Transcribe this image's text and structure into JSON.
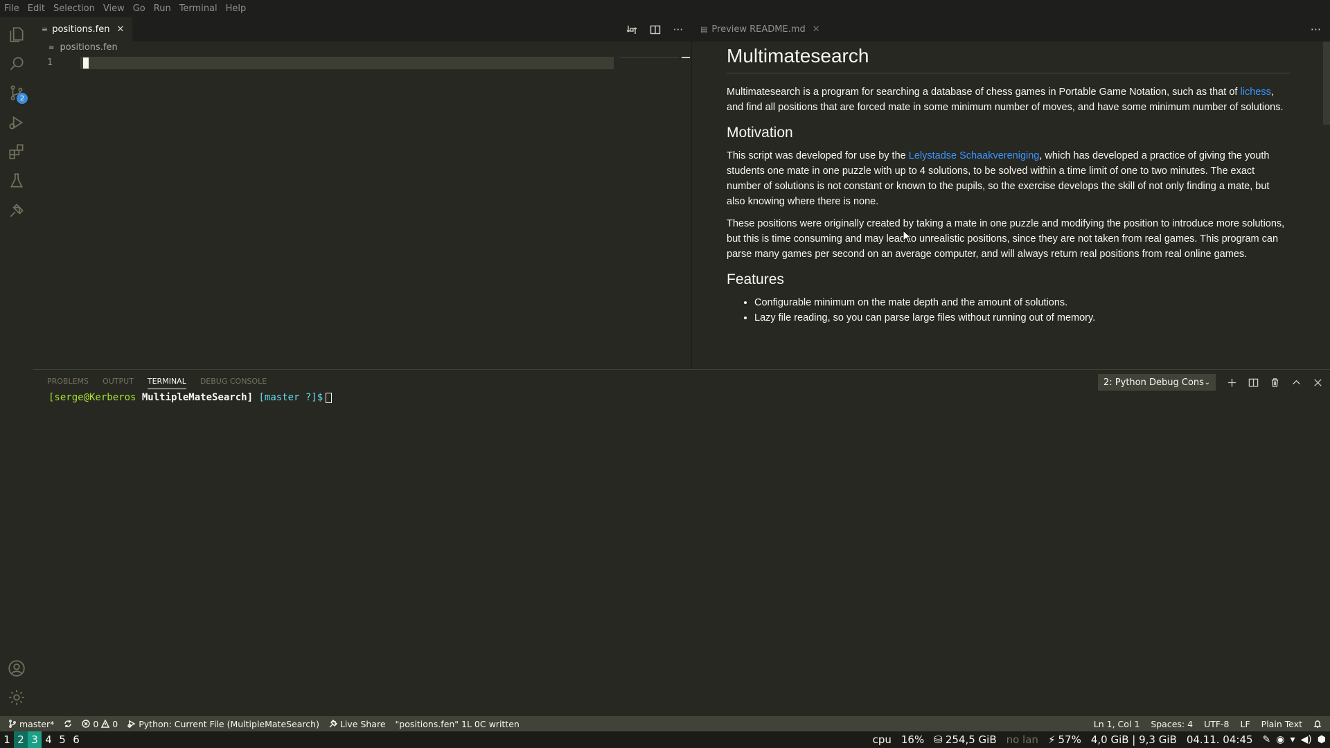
{
  "menu": [
    "File",
    "Edit",
    "Selection",
    "View",
    "Go",
    "Run",
    "Terminal",
    "Help"
  ],
  "activity": {
    "source_control_badge": "2"
  },
  "editor1": {
    "tab_label": "positions.fen",
    "tab_close": "✕",
    "breadcrumb": "positions.fen",
    "line_number": "1",
    "more": "···"
  },
  "editor2": {
    "tab_label": "Preview README.md",
    "tab_close": "✕",
    "more": "···",
    "doc": {
      "h1": "Multimatesearch",
      "p1_a": "Multimatesearch is a program for searching a database of chess games in Portable Game Notation, such as that of ",
      "p1_link": "lichess",
      "p1_b": ", and find all positions that are forced mate in some minimum number of moves, and have some minimum number of solutions.",
      "h2_motivation": "Motivation",
      "p2_a": "This script was developed for use by the ",
      "p2_link": "Lelystadse Schaakvereniging",
      "p2_b": ", which has developed a practice of giving the youth students one mate in one puzzle with up to 4 solutions, to be solved within a time limit of one to two minutes. The exact number of solutions is not constant or known to the pupils, so the exercise develops the skill of not only finding a mate, but also knowing where there is none.",
      "p3": "These positions were originally created by taking a mate in one puzzle and modifying the position to introduce more solutions, but this is time consuming and may lead to unrealistic positions, since they are not taken from real games. This program can parse many games per second on an average computer, and will always return real positions from real online games.",
      "h2_features": "Features",
      "features": [
        "Configurable minimum on the mate depth and the amount of solutions.",
        "Lazy file reading, so you can parse large files without running out of memory."
      ]
    }
  },
  "panel": {
    "tabs": [
      "PROBLEMS",
      "OUTPUT",
      "TERMINAL",
      "DEBUG CONSOLE"
    ],
    "active_tab": "TERMINAL",
    "terminal_select": "2: Python Debug Cons",
    "prompt_user": "[serge@Kerberos",
    "prompt_dir": "MultipleMateSearch]",
    "prompt_branch": "[master ?]$"
  },
  "status": {
    "branch": "master*",
    "errors": "0",
    "warnings": "0",
    "debug_config": "Python: Current File (MultipleMateSearch)",
    "live_share": "Live Share",
    "message": "\"positions.fen\" 1L 0C written",
    "position": "Ln 1, Col 1",
    "spaces": "Spaces: 4",
    "encoding": "UTF-8",
    "eol": "LF",
    "language": "Plain Text"
  },
  "taskbar": {
    "workspaces": [
      "1",
      "2",
      "3",
      "4",
      "5",
      "6"
    ],
    "cpu_label": "cpu",
    "cpu_value": "16%",
    "disk": "254,5 GiB",
    "network": "no lan",
    "battery": "57%",
    "memory": "4,0 GiB | 9,3 GiB",
    "datetime": "04.11. 04:45"
  }
}
